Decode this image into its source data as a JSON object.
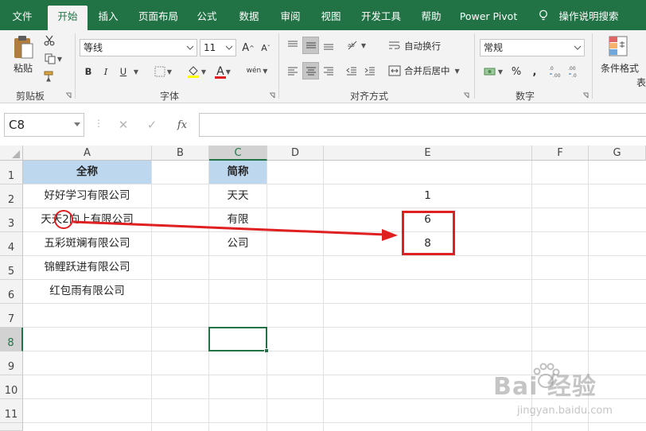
{
  "ribbon_tabs": [
    "文件",
    "开始",
    "插入",
    "页面布局",
    "公式",
    "数据",
    "审阅",
    "视图",
    "开发工具",
    "帮助",
    "Power Pivot",
    "操作说明搜索"
  ],
  "ribbon": {
    "clipboard": {
      "paste_label": "粘贴",
      "group_label": "剪贴板"
    },
    "font": {
      "font_name": "等线",
      "font_size": "11",
      "bold": "B",
      "italic": "I",
      "underline": "U",
      "font_color_glyph": "A",
      "phonetic": "wén",
      "group_label": "字体"
    },
    "alignment": {
      "wrap_text": "自动换行",
      "merge_center": "合并后居中",
      "group_label": "对齐方式"
    },
    "number": {
      "format": "常规",
      "percent": "%",
      "group_label": "数字"
    },
    "styles": {
      "conditional_format": "条件格式",
      "table_partial": "表"
    }
  },
  "formula_bar": {
    "name_box": "C8",
    "formula": "",
    "fx": "fx"
  },
  "grid": {
    "columns": [
      "A",
      "B",
      "C",
      "D",
      "E",
      "F",
      "G"
    ],
    "rows": [
      "1",
      "2",
      "3",
      "4",
      "5",
      "6",
      "7",
      "8",
      "9",
      "10",
      "11"
    ],
    "active_cell": "C8",
    "cells": {
      "A1": "全称",
      "C1": "简称",
      "A2": "好好学习有限公司",
      "C2": "天天",
      "E2": "1",
      "A3": "天天2向上有限公司",
      "C3": "有限",
      "E3": "6",
      "A4": "五彩斑斓有限公司",
      "C4": "公司",
      "E4": "8",
      "A5": "锦鲤跃进有限公司",
      "A6": "红包雨有限公司"
    }
  },
  "watermark": {
    "brand": "Bai  经验",
    "url": "jingyan.baidu.com"
  },
  "colors": {
    "ribbon_green": "#217346",
    "header_fill": "#bdd7ee",
    "annotation_red": "#e02020"
  }
}
